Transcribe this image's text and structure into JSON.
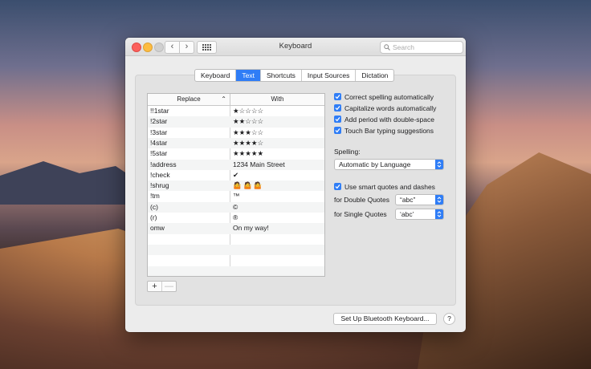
{
  "window": {
    "title": "Keyboard"
  },
  "search": {
    "placeholder": "Search"
  },
  "tabs": [
    {
      "label": "Keyboard",
      "active": false
    },
    {
      "label": "Text",
      "active": true
    },
    {
      "label": "Shortcuts",
      "active": false
    },
    {
      "label": "Input Sources",
      "active": false
    },
    {
      "label": "Dictation",
      "active": false
    }
  ],
  "table": {
    "headers": {
      "replace": "Replace",
      "with": "With"
    },
    "rows": [
      {
        "replace": "!!1star",
        "with": "★☆☆☆☆"
      },
      {
        "replace": "!2star",
        "with": "★★☆☆☆"
      },
      {
        "replace": "!3star",
        "with": "★★★☆☆"
      },
      {
        "replace": "!4star",
        "with": "★★★★☆"
      },
      {
        "replace": "!5star",
        "with": "★★★★★"
      },
      {
        "replace": "!address",
        "with": "1234 Main Street"
      },
      {
        "replace": "!check",
        "with": "✔"
      },
      {
        "replace": "!shrug",
        "with": "🤷 🤷 🤷"
      },
      {
        "replace": "!tm",
        "with": "™"
      },
      {
        "replace": "(c)",
        "with": "©"
      },
      {
        "replace": "(r)",
        "with": "®"
      },
      {
        "replace": "omw",
        "with": "On my way!"
      }
    ]
  },
  "table_buttons": {
    "add": "+",
    "remove": "—"
  },
  "options": [
    {
      "label": "Correct spelling automatically",
      "checked": true
    },
    {
      "label": "Capitalize words automatically",
      "checked": true
    },
    {
      "label": "Add period with double-space",
      "checked": true
    },
    {
      "label": "Touch Bar typing suggestions",
      "checked": true
    }
  ],
  "spelling": {
    "label": "Spelling:",
    "value": "Automatic by Language"
  },
  "smart_quotes": {
    "label": "Use smart quotes and dashes",
    "checked": true,
    "double_label": "for Double Quotes",
    "double_value": "“abc”",
    "single_label": "for Single Quotes",
    "single_value": "‘abc’"
  },
  "footer": {
    "bluetooth_button": "Set Up Bluetooth Keyboard...",
    "help": "?"
  },
  "colors": {
    "accent": "#2f7df6",
    "close": "#fc605c",
    "minimize": "#fdbc40"
  }
}
